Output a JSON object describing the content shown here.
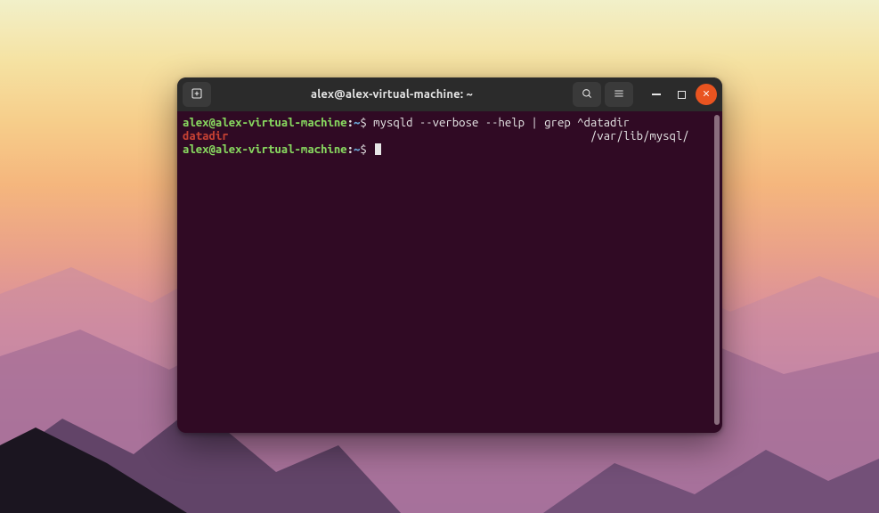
{
  "window": {
    "title": "alex@alex-virtual-machine: ~"
  },
  "prompt": {
    "user_host": "alex@alex-virtual-machine",
    "separator1": ":",
    "path": "~",
    "dollar": "$"
  },
  "terminal": {
    "line1_cmd": " mysqld --verbose --help | grep ^datadir",
    "line2_match": "datadir",
    "line2_value_spaces": "                                                       ",
    "line2_value": "/var/lib/mysql/"
  },
  "icons": {
    "new_tab": "new-tab-icon",
    "search": "search-icon",
    "menu": "hamburger-menu-icon",
    "minimize": "minimize-icon",
    "maximize": "maximize-icon",
    "close": "close-icon"
  }
}
